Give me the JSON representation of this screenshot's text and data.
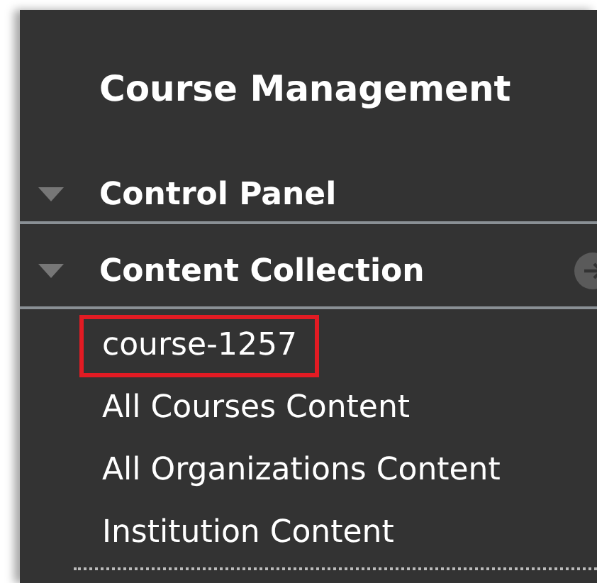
{
  "title": "Course Management",
  "sections": [
    {
      "label": "Control Panel",
      "expanded": true,
      "has_arrow": false
    },
    {
      "label": "Content Collection",
      "expanded": true,
      "has_arrow": true,
      "items": [
        {
          "label": "course-1257",
          "highlighted": true
        },
        {
          "label": "All Courses Content",
          "highlighted": false
        },
        {
          "label": "All Organizations Content",
          "highlighted": false
        },
        {
          "label": "Institution Content",
          "highlighted": false
        }
      ]
    }
  ]
}
